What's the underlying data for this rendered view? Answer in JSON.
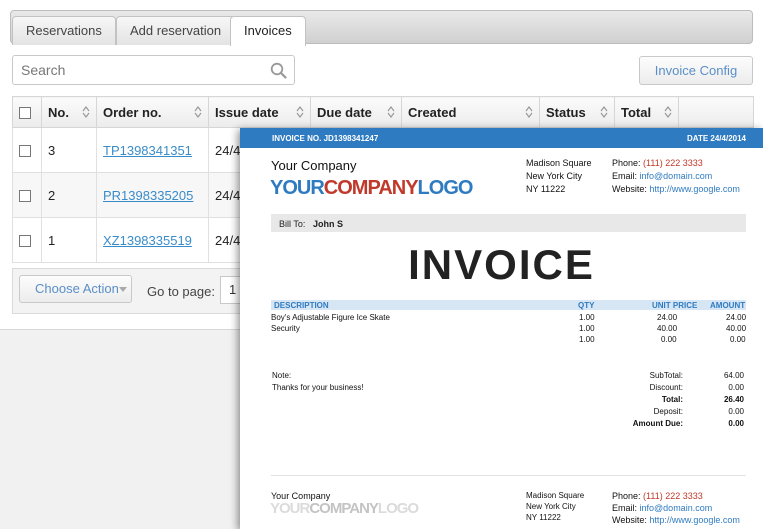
{
  "tabs": [
    {
      "label": "Reservations"
    },
    {
      "label": "Add reservation"
    },
    {
      "label": "Invoices"
    }
  ],
  "search": {
    "placeholder": "Search"
  },
  "toolbar": {
    "config_label": "Invoice Config"
  },
  "table": {
    "columns": [
      "No.",
      "Order no.",
      "Issue date",
      "Due date",
      "Created",
      "Status",
      "Total"
    ],
    "rows": [
      {
        "no": "3",
        "order": "TP1398341351",
        "issue": "24/4"
      },
      {
        "no": "2",
        "order": "PR1398335205",
        "issue": "24/4"
      },
      {
        "no": "1",
        "order": "XZ1398335519",
        "issue": "24/4"
      }
    ]
  },
  "footer": {
    "choose_action": "Choose Action",
    "goto_label": "Go to page:",
    "page": "1"
  },
  "invoice": {
    "number_label": "INVOICE NO. JD1398341247",
    "date_label": "DATE 24/4/2014",
    "company": "Your Company",
    "logo_part1": "YOUR",
    "logo_part2": "COMPANY",
    "logo_part3": "LOGO",
    "address": [
      "Madison Square",
      "New York City",
      "NY 11222"
    ],
    "phone_label": "Phone:",
    "phone": "(111) 222 3333",
    "email_label": "Email:",
    "email": "info@domain.com",
    "website_label": "Website:",
    "website": "http://www.google.com",
    "bill_to_label": "Bill To:",
    "bill_to_name": "John S",
    "title": "INVOICE",
    "headers": {
      "description": "DESCRIPTION",
      "qty": "QTY",
      "unit_price": "UNIT PRICE",
      "amount": "AMOUNT"
    },
    "items": [
      {
        "description": "Boy's Adjustable Figure Ice Skate",
        "qty": "1.00",
        "unit_price": "24.00",
        "amount": "24.00"
      },
      {
        "description": "Security",
        "qty": "1.00",
        "unit_price": "40.00",
        "amount": "40.00"
      },
      {
        "description": "",
        "qty": "1.00",
        "unit_price": "0.00",
        "amount": "0.00"
      }
    ],
    "note_label": "Note:",
    "note": "Thanks for your business!",
    "totals": [
      {
        "label": "SubTotal:",
        "value": "64.00",
        "bold": false
      },
      {
        "label": "Discount:",
        "value": "0.00",
        "bold": false
      },
      {
        "label": "Total:",
        "value": "26.40",
        "bold": true
      },
      {
        "label": "Deposit:",
        "value": "0.00",
        "bold": false
      },
      {
        "label": "Amount Due:",
        "value": "0.00",
        "bold": true
      }
    ]
  },
  "colors": {
    "accent": "#2f7bc1",
    "logo_red": "#c0392b",
    "link": "#3a8cc9"
  },
  "icons": {
    "search": "search-icon",
    "sort": "sort-arrows-icon",
    "caret": "caret-down-icon"
  }
}
